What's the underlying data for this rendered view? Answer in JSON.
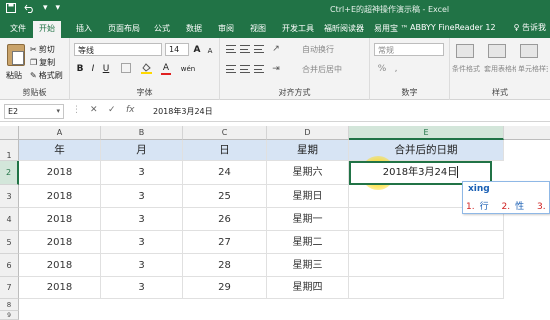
{
  "window": {
    "title": "Ctrl+E的超神操作演示稿 - Excel"
  },
  "qat": {
    "save_icon": "save-icon",
    "undo_icon": "undo-icon",
    "undo_more": "▾",
    "customize": "▾"
  },
  "tabs": [
    "文件",
    "开始",
    "插入",
    "页面布局",
    "公式",
    "数据",
    "审阅",
    "视图",
    "开发工具",
    "福昕阅读器",
    "易用宝 ™",
    "ABBYY FineReader 12"
  ],
  "active_tab": "开始",
  "tell_me": "♀ 告诉我",
  "ribbon": {
    "clipboard": {
      "paste": "粘贴",
      "cut": "剪切",
      "copy": "复制",
      "format_painter": "格式刷",
      "label": "剪贴板"
    },
    "font": {
      "name": "等线",
      "size": "14",
      "bold": "B",
      "italic": "I",
      "underline": "U",
      "grow": "A",
      "shrink": "A",
      "font_color": "A",
      "wen": "wén",
      "label": "字体"
    },
    "alignment": {
      "wrap": "自动换行",
      "merge": "合并后居中",
      "label": "对齐方式"
    },
    "number": {
      "format": "常规",
      "currency": "%",
      "comma": ",",
      "label": "数字"
    },
    "styles": {
      "conditional": "条件格式",
      "table": "套用表格格式",
      "cell": "单元格样式",
      "label": "样式"
    }
  },
  "formula_bar": {
    "name_box": "E2",
    "cancel": "✕",
    "enter": "✓",
    "fx": "fx",
    "formula": "2018年3月24日"
  },
  "columns": [
    "A",
    "B",
    "C",
    "D",
    "E"
  ],
  "rows": [
    "1",
    "2",
    "3",
    "4",
    "5",
    "6",
    "7",
    "8",
    "9"
  ],
  "headers": [
    "年",
    "月",
    "日",
    "星期",
    "合并后的日期"
  ],
  "data_rows": [
    [
      "2018",
      "3",
      "24",
      "星期六"
    ],
    [
      "2018",
      "3",
      "25",
      "星期日"
    ],
    [
      "2018",
      "3",
      "26",
      "星期一"
    ],
    [
      "2018",
      "3",
      "27",
      "星期二"
    ],
    [
      "2018",
      "3",
      "28",
      "星期三"
    ],
    [
      "2018",
      "3",
      "29",
      "星期四"
    ]
  ],
  "active_cell": {
    "ref": "E2",
    "value": "2018年3月24日"
  },
  "ime": {
    "pinyin": "xing",
    "candidates": [
      {
        "num": "1.",
        "text": "行"
      },
      {
        "num": "2.",
        "text": "性"
      },
      {
        "num": "3.",
        "text": "醒 ‹"
      }
    ]
  },
  "colors": {
    "excel_green": "#217346",
    "header_fill": "#d7e4f4",
    "selected_header": "#d3e6da"
  }
}
